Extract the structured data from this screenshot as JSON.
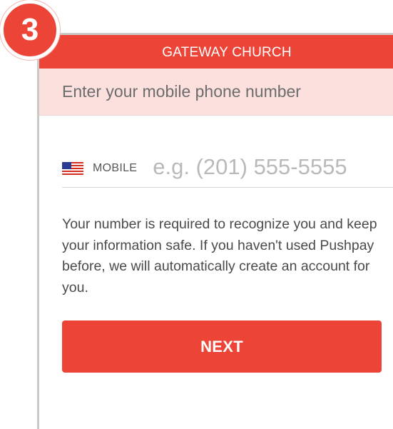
{
  "step": {
    "number": "3"
  },
  "header": {
    "title": "GATEWAY CHURCH"
  },
  "banner": {
    "prompt": "Enter your mobile phone number"
  },
  "phone": {
    "flag_icon": "us-flag-icon",
    "label": "MOBILE",
    "value": "",
    "placeholder": "e.g. (201) 555-5555"
  },
  "info": {
    "text": "Your number is required to recognize you and keep your information safe. If you haven't used Pushpay before, we will automatically create an account for you."
  },
  "actions": {
    "next_label": "NEXT"
  },
  "colors": {
    "accent": "#ec4538",
    "banner_bg": "#fbe0de"
  }
}
